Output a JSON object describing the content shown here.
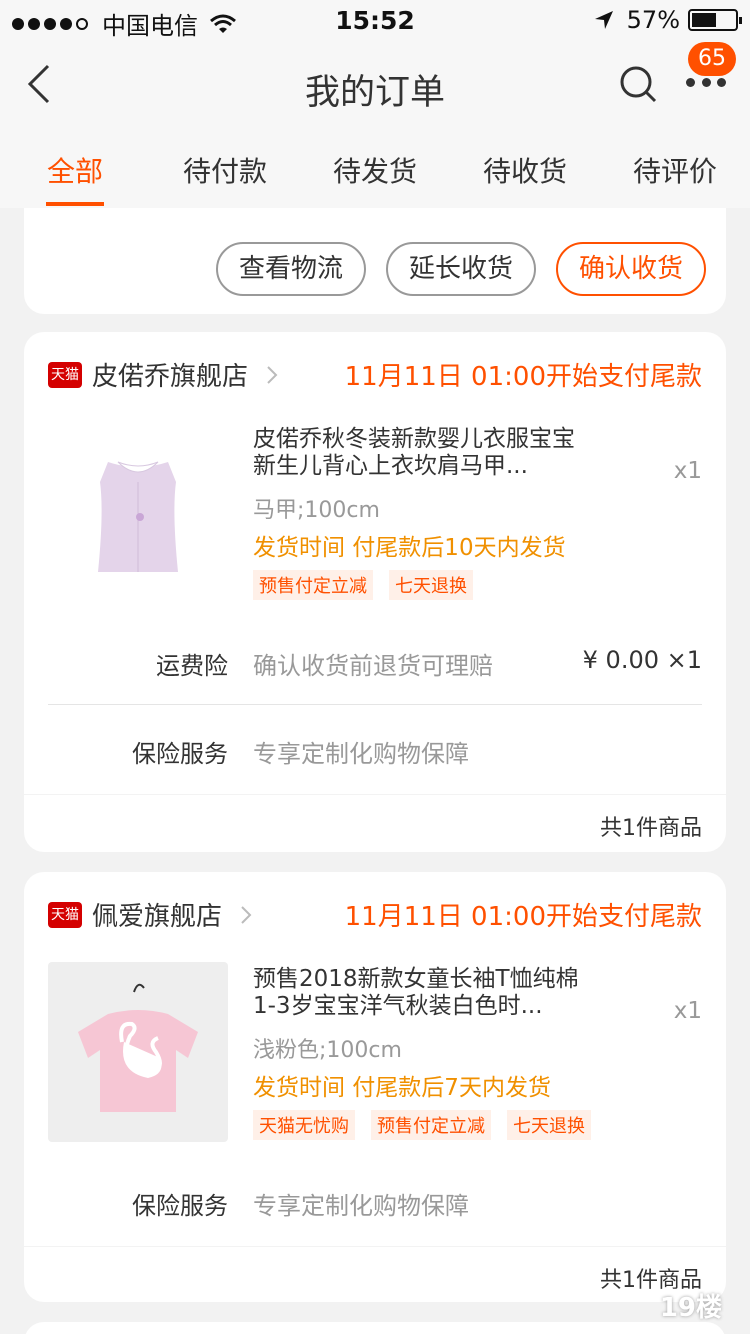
{
  "status_bar": {
    "carrier": "中国电信",
    "time": "15:52",
    "battery": "57%",
    "battery_level": 0.57
  },
  "nav": {
    "title": "我的订单",
    "badge": "65"
  },
  "tabs": [
    {
      "label": "全部",
      "active": true
    },
    {
      "label": "待付款"
    },
    {
      "label": "待发货"
    },
    {
      "label": "待收货"
    },
    {
      "label": "待评价"
    }
  ],
  "top_card": {
    "buttons": [
      "查看物流",
      "延长收货",
      "确认收货"
    ]
  },
  "orders": [
    {
      "tmall_badge": "天猫",
      "shop": "皮偌乔旗舰店",
      "pay_note": "11月11日 01:00开始支付尾款",
      "product_title": "皮偌乔秋冬装新款婴儿衣服宝宝新生儿背心上衣坎肩马甲...",
      "qty": "x1",
      "sku": "马甲;100cm",
      "ship_time": "发货时间 付尾款后10天内发货",
      "tags": [
        "预售付定立减",
        "七天退换"
      ],
      "freight_label": "运费险",
      "freight_desc": "确认收货前退货可理赔",
      "freight_price": "¥ 0.00 ×1",
      "insurance_label": "保险服务",
      "insurance_desc": "专享定制化购物保障",
      "total": "共1件商品"
    },
    {
      "tmall_badge": "天猫",
      "shop": "佩爱旗舰店",
      "pay_note": "11月11日 01:00开始支付尾款",
      "product_title": "预售2018新款女童长袖T恤纯棉1-3岁宝宝洋气秋装白色时...",
      "qty": "x1",
      "sku": "浅粉色;100cm",
      "ship_time": "发货时间 付尾款后7天内发货",
      "tags": [
        "天猫无忧购",
        "预售付定立减",
        "七天退换"
      ],
      "insurance_label": "保险服务",
      "insurance_desc": "专享定制化购物保障",
      "total": "共1件商品"
    }
  ],
  "watermark": "19楼"
}
